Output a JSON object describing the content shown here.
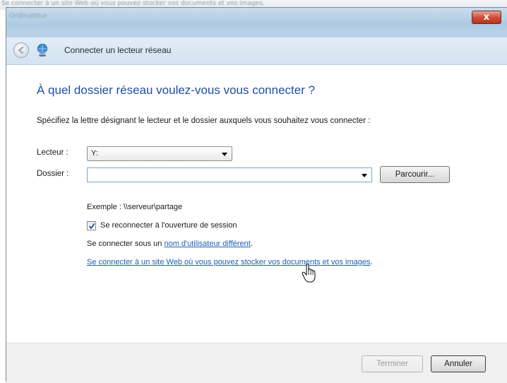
{
  "background": {
    "blurred_text": "Se connecter à un site Web où vous pouvez stocker vos documents et vos images.",
    "titlebar_blur_text": "Ordinateur"
  },
  "window": {
    "close_label": "x",
    "nav_title": "Connecter un lecteur réseau",
    "icons": [
      "back-arrow-icon",
      "network-drive-icon",
      "close-icon",
      "checkmark-icon",
      "hand-cursor-icon"
    ]
  },
  "content": {
    "heading": "À quel dossier réseau voulez-vous vous connecter ?",
    "instruction": "Spécifiez la lettre désignant le lecteur et le dossier auxquels vous souhaitez vous connecter :",
    "drive_label": "Lecteur :",
    "drive_value": "Y:",
    "folder_label": "Dossier :",
    "folder_value": "",
    "browse_label": "Parcourir...",
    "example_text": "Exemple : \\\\serveur\\partage",
    "reconnect_label": "Se reconnecter à l'ouverture de session",
    "reconnect_checked": true,
    "connect_as_prefix": "Se connecter sous un ",
    "connect_as_link": "nom d'utilisateur différent",
    "connect_as_suffix": ".",
    "website_link": "Se connecter à un site Web où vous pouvez stocker vos documents et vos images",
    "website_suffix": "."
  },
  "footer": {
    "finish_label": "Terminer",
    "cancel_label": "Annuler"
  },
  "colors": {
    "heading": "#1f4fa0",
    "link": "#1d5fb0",
    "close_button": "#cf4f3d"
  }
}
